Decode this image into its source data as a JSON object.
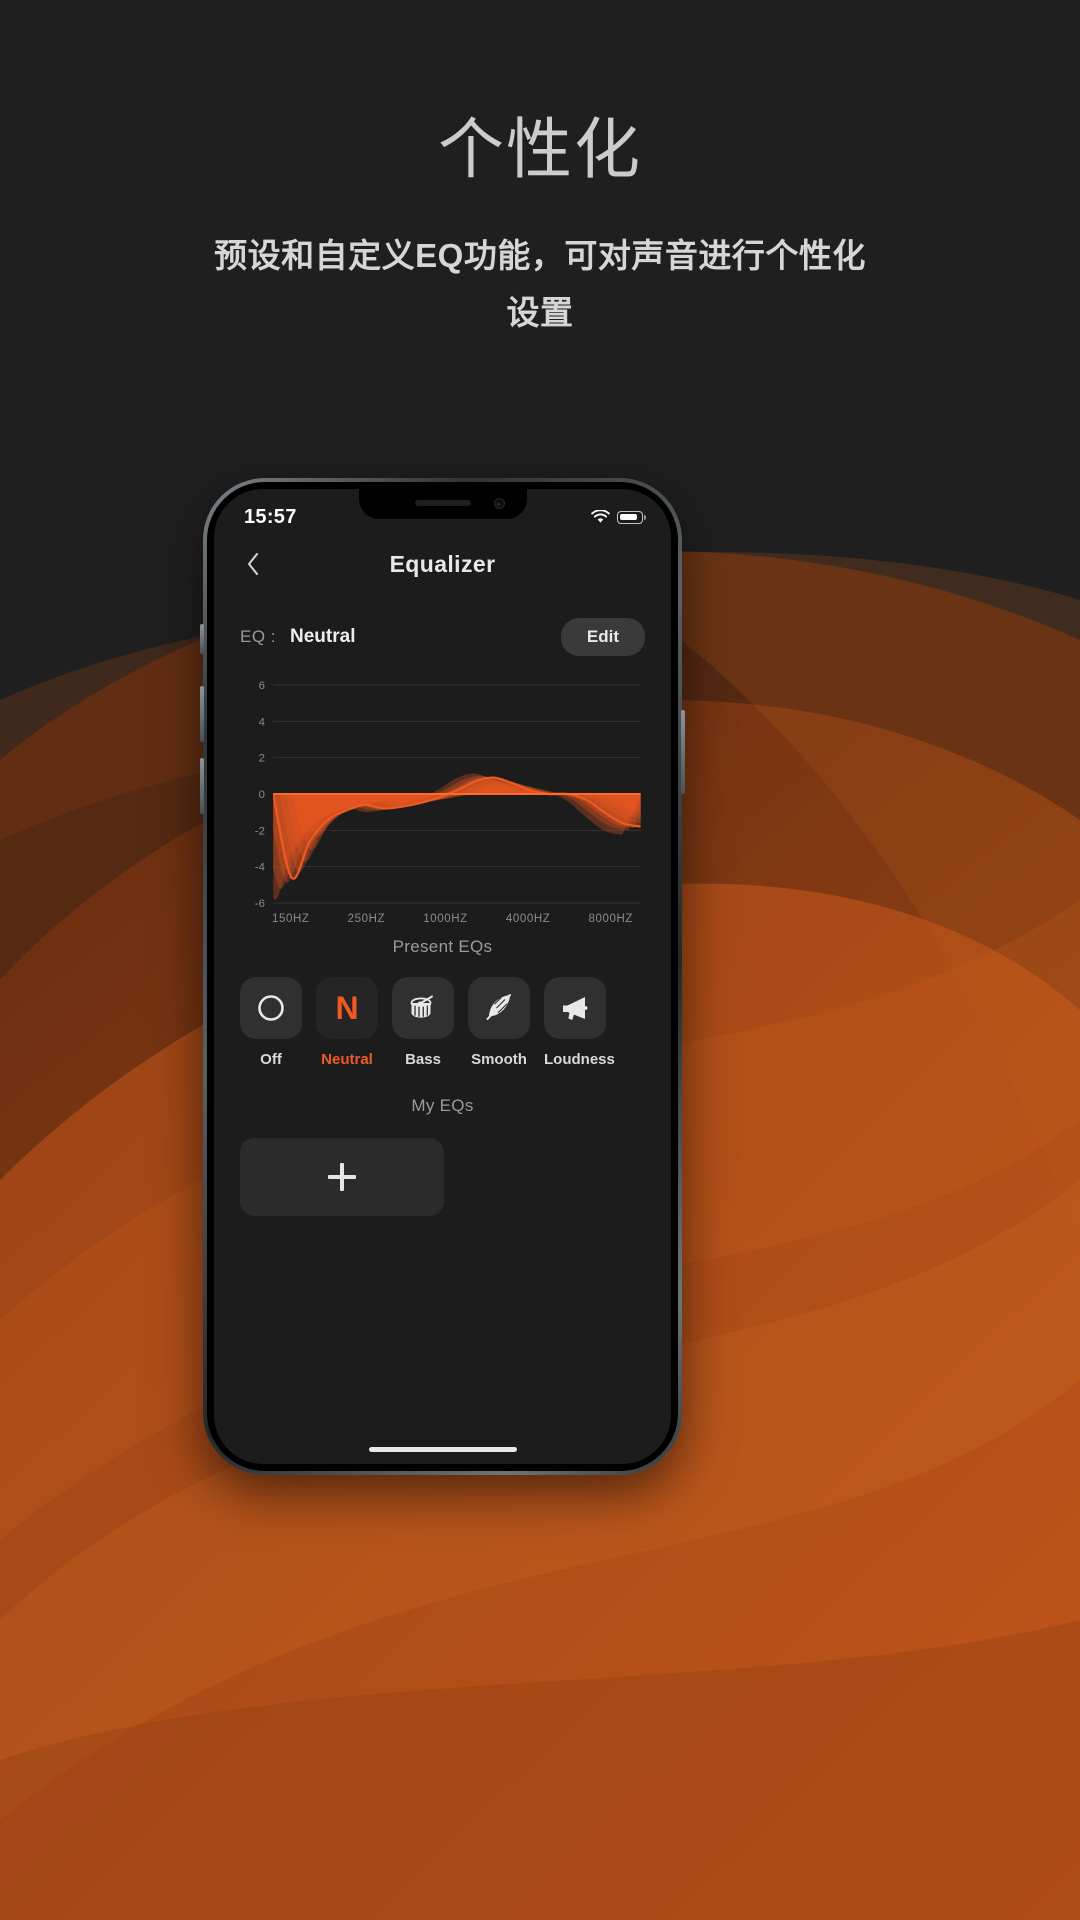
{
  "hero": {
    "title": "个性化",
    "subtitle": "预设和自定义EQ功能，可对声音进行个性化设置"
  },
  "colors": {
    "page_bg": "#1f1f1f",
    "accent": "#f05a22",
    "accent_dark": "#8a3a16",
    "screen_bg": "#1c1c1c",
    "tile_bg": "#303030",
    "muted_text": "#9a9a9a"
  },
  "phone": {
    "statusbar": {
      "time": "15:57",
      "wifi_icon": "wifi-icon",
      "battery_icon": "battery-icon"
    },
    "navbar": {
      "back_icon": "chevron-left-icon",
      "title": "Equalizer"
    },
    "eq_header": {
      "label": "EQ :",
      "value": "Neutral",
      "edit_label": "Edit"
    },
    "sections": {
      "present_eqs": "Present EQs",
      "my_eqs": "My EQs"
    },
    "presets": [
      {
        "label": "Off",
        "icon": "circle-outline-icon",
        "selected": false
      },
      {
        "label": "Neutral",
        "icon": "letter-n-icon",
        "selected": true
      },
      {
        "label": "Bass",
        "icon": "drum-icon",
        "selected": false
      },
      {
        "label": "Smooth",
        "icon": "feather-icon",
        "selected": false
      },
      {
        "label": "Loudness",
        "icon": "megaphone-icon",
        "selected": false
      }
    ],
    "my_eqs": {
      "add_icon": "plus-icon"
    },
    "home_indicator": "home-indicator"
  },
  "chart_data": {
    "type": "line",
    "title": "",
    "xlabel": "",
    "ylabel": "",
    "ylim": [
      -6,
      6
    ],
    "yticks": [
      6,
      4,
      2,
      0,
      -2,
      -4,
      -6
    ],
    "xticks": [
      "150HZ",
      "250HZ",
      "1000HZ",
      "4000HZ",
      "8000HZ"
    ],
    "grid": true,
    "legend": "none",
    "x": [
      0,
      1,
      2,
      3,
      4,
      5,
      6,
      7,
      8,
      9,
      10,
      11,
      12,
      13,
      14,
      15,
      16,
      17,
      18,
      19,
      20
    ],
    "series": [
      {
        "name": "Neutral EQ response",
        "values": [
          0,
          -4.6,
          -2.6,
          -1.4,
          -0.9,
          -0.6,
          -0.8,
          -0.7,
          -0.5,
          -0.2,
          0.2,
          0.7,
          0.9,
          0.6,
          0.2,
          0,
          0,
          -0.3,
          -1.0,
          -1.6,
          -1.8
        ]
      }
    ]
  }
}
